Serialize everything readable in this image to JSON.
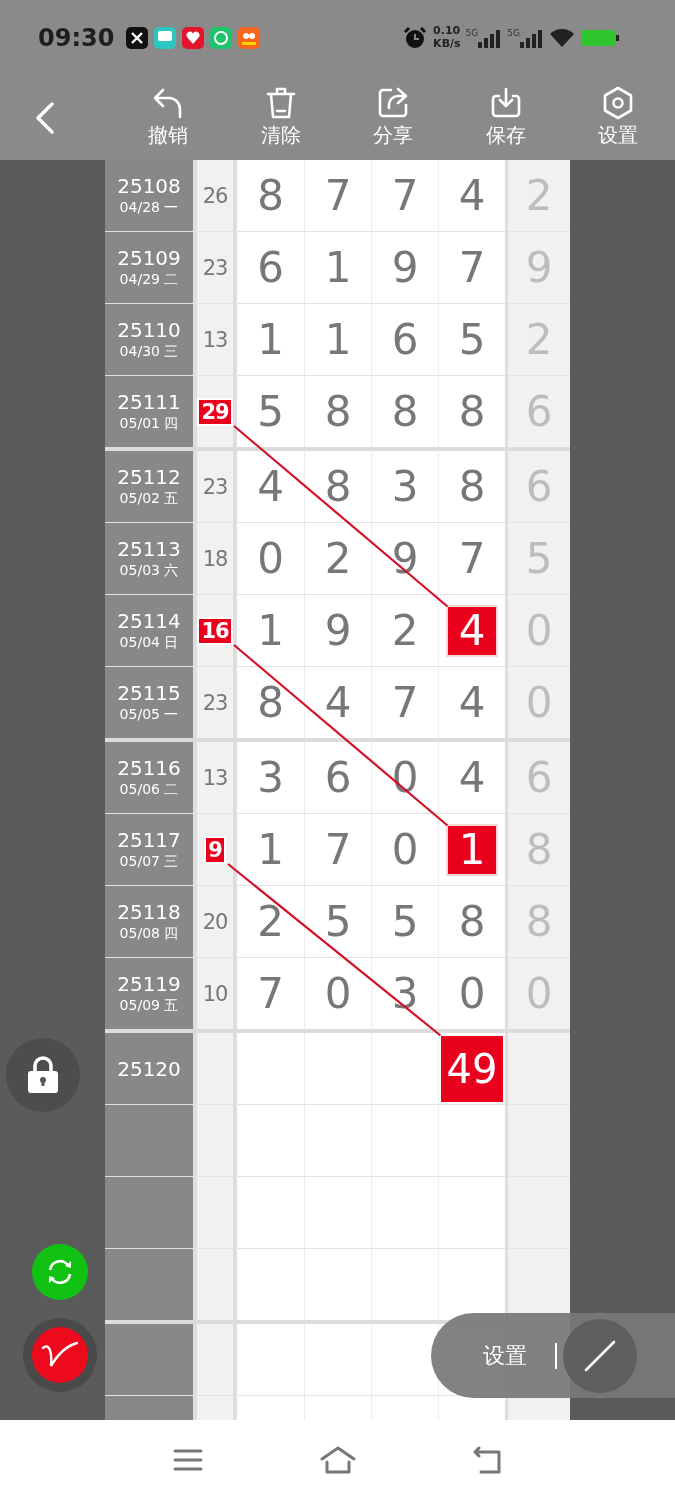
{
  "status_bar": {
    "time": "09:30",
    "net_speed": "0.10",
    "net_unit": "KB/s",
    "networks": [
      "5G",
      "5G"
    ]
  },
  "toolbar": {
    "actions": [
      {
        "kind": "undo",
        "label": "撤销"
      },
      {
        "kind": "clear",
        "label": "清除"
      },
      {
        "kind": "share",
        "label": "分享"
      },
      {
        "kind": "save",
        "label": "保存"
      },
      {
        "kind": "settings",
        "label": "设置"
      }
    ]
  },
  "rows": [
    {
      "kind": "drawn",
      "period": "25108",
      "date": "04/28 一",
      "sum": {
        "value": "26",
        "marked": false
      },
      "digits": [
        {
          "value": "8",
          "marked": false
        },
        {
          "value": "7",
          "marked": false
        },
        {
          "value": "7",
          "marked": false
        },
        {
          "value": "4",
          "marked": false
        }
      ],
      "tail": "2"
    },
    {
      "kind": "drawn",
      "period": "25109",
      "date": "04/29 二",
      "sum": {
        "value": "23",
        "marked": false
      },
      "digits": [
        {
          "value": "6",
          "marked": false
        },
        {
          "value": "1",
          "marked": false
        },
        {
          "value": "9",
          "marked": false
        },
        {
          "value": "7",
          "marked": false
        }
      ],
      "tail": "9"
    },
    {
      "kind": "drawn",
      "period": "25110",
      "date": "04/30 三",
      "sum": {
        "value": "13",
        "marked": false
      },
      "digits": [
        {
          "value": "1",
          "marked": false
        },
        {
          "value": "1",
          "marked": false
        },
        {
          "value": "6",
          "marked": false
        },
        {
          "value": "5",
          "marked": false
        }
      ],
      "tail": "2"
    },
    {
      "kind": "drawn",
      "period": "25111",
      "date": "05/01 四",
      "sum": {
        "value": "29",
        "marked": true
      },
      "digits": [
        {
          "value": "5",
          "marked": false
        },
        {
          "value": "8",
          "marked": false
        },
        {
          "value": "8",
          "marked": false
        },
        {
          "value": "8",
          "marked": false
        }
      ],
      "tail": "6"
    },
    {
      "kind": "drawn",
      "period": "25112",
      "date": "05/02 五",
      "sum": {
        "value": "23",
        "marked": false
      },
      "digits": [
        {
          "value": "4",
          "marked": false
        },
        {
          "value": "8",
          "marked": false
        },
        {
          "value": "3",
          "marked": false
        },
        {
          "value": "8",
          "marked": false
        }
      ],
      "tail": "6"
    },
    {
      "kind": "drawn",
      "period": "25113",
      "date": "05/03 六",
      "sum": {
        "value": "18",
        "marked": false
      },
      "digits": [
        {
          "value": "0",
          "marked": false
        },
        {
          "value": "2",
          "marked": false
        },
        {
          "value": "9",
          "marked": false
        },
        {
          "value": "7",
          "marked": false
        }
      ],
      "tail": "5"
    },
    {
      "kind": "drawn",
      "period": "25114",
      "date": "05/04 日",
      "sum": {
        "value": "16",
        "marked": true
      },
      "digits": [
        {
          "value": "1",
          "marked": false
        },
        {
          "value": "9",
          "marked": false
        },
        {
          "value": "2",
          "marked": false
        },
        {
          "value": "4",
          "marked": true
        }
      ],
      "tail": "0"
    },
    {
      "kind": "drawn",
      "period": "25115",
      "date": "05/05 一",
      "sum": {
        "value": "23",
        "marked": false
      },
      "digits": [
        {
          "value": "8",
          "marked": false
        },
        {
          "value": "4",
          "marked": false
        },
        {
          "value": "7",
          "marked": false
        },
        {
          "value": "4",
          "marked": false
        }
      ],
      "tail": "0"
    },
    {
      "kind": "drawn",
      "period": "25116",
      "date": "05/06 二",
      "sum": {
        "value": "13",
        "marked": false
      },
      "digits": [
        {
          "value": "3",
          "marked": false
        },
        {
          "value": "6",
          "marked": false
        },
        {
          "value": "0",
          "marked": false
        },
        {
          "value": "4",
          "marked": false
        }
      ],
      "tail": "6"
    },
    {
      "kind": "drawn",
      "period": "25117",
      "date": "05/07 三",
      "sum": {
        "value": "9",
        "marked": true
      },
      "digits": [
        {
          "value": "1",
          "marked": false
        },
        {
          "value": "7",
          "marked": false
        },
        {
          "value": "0",
          "marked": false
        },
        {
          "value": "1",
          "marked": true
        }
      ],
      "tail": "8"
    },
    {
      "kind": "drawn",
      "period": "25118",
      "date": "05/08 四",
      "sum": {
        "value": "20",
        "marked": false
      },
      "digits": [
        {
          "value": "2",
          "marked": false
        },
        {
          "value": "5",
          "marked": false
        },
        {
          "value": "5",
          "marked": false
        },
        {
          "value": "8",
          "marked": false
        }
      ],
      "tail": "8"
    },
    {
      "kind": "drawn",
      "period": "25119",
      "date": "05/09 五",
      "sum": {
        "value": "10",
        "marked": false
      },
      "digits": [
        {
          "value": "7",
          "marked": false
        },
        {
          "value": "0",
          "marked": false
        },
        {
          "value": "3",
          "marked": false
        },
        {
          "value": "0",
          "marked": false
        }
      ],
      "tail": "0"
    },
    {
      "kind": "pending",
      "period": "25120",
      "pick": "49"
    }
  ],
  "floating_menu": {
    "label": "设置"
  }
}
